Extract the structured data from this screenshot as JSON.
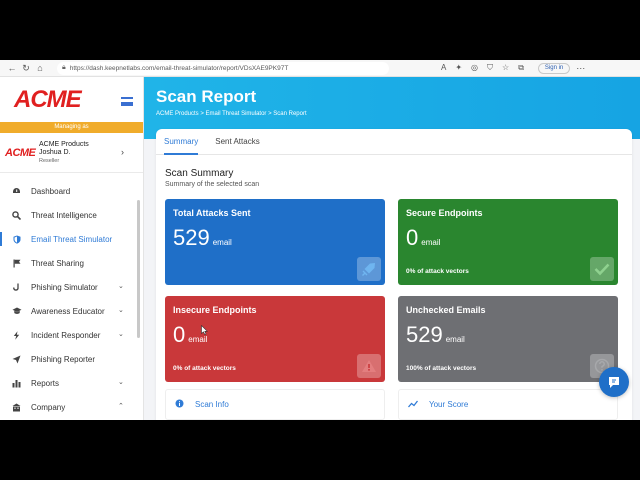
{
  "browser": {
    "url": "https://dash.keepnetlabs.com/email-threat-simulator/report/VDsXAE9PK97T",
    "sign_in_label": "Sign in"
  },
  "sidebar": {
    "brand": "ACME",
    "managing_label": "Managing as",
    "account": {
      "company": "ACME Products",
      "user": "Joshua D.",
      "role": "Reseller"
    },
    "items": [
      {
        "label": "Dashboard",
        "icon": "dashboard-icon"
      },
      {
        "label": "Threat Intelligence",
        "icon": "search-icon"
      },
      {
        "label": "Email Threat Simulator",
        "icon": "shield-icon",
        "active": true
      },
      {
        "label": "Threat Sharing",
        "icon": "flag-icon"
      },
      {
        "label": "Phishing Simulator",
        "icon": "hook-icon",
        "expandable": true
      },
      {
        "label": "Awareness Educator",
        "icon": "graduation-cap-icon",
        "expandable": true
      },
      {
        "label": "Incident Responder",
        "icon": "bolt-icon",
        "expandable": true
      },
      {
        "label": "Phishing Reporter",
        "icon": "paper-plane-icon"
      },
      {
        "label": "Reports",
        "icon": "bar-chart-icon",
        "expandable": true
      },
      {
        "label": "Company",
        "icon": "building-icon",
        "expandable": true,
        "expanded": true
      }
    ]
  },
  "header": {
    "title": "Scan Report",
    "breadcrumb": "ACME Products > Email Threat Simulator > Scan Report"
  },
  "tabs": [
    {
      "label": "Summary",
      "active": true
    },
    {
      "label": "Sent Attacks"
    }
  ],
  "summary": {
    "title": "Scan Summary",
    "subtitle": "Summary of the selected scan",
    "tiles": [
      {
        "label": "Total Attacks Sent",
        "value": "529",
        "unit": "email",
        "footer": "",
        "color": "#1f6fc8",
        "icon": "sword-icon"
      },
      {
        "label": "Secure Endpoints",
        "value": "0",
        "unit": "email",
        "footer": "0% of attack vectors",
        "color": "#2a862f",
        "icon": "check-icon"
      },
      {
        "label": "Insecure Endpoints",
        "value": "0",
        "unit": "email",
        "footer": "0% of attack vectors",
        "color": "#c9383a",
        "icon": "warning-icon"
      },
      {
        "label": "Unchecked Emails",
        "value": "529",
        "unit": "email",
        "footer": "100% of attack vectors",
        "color": "#6e6f73",
        "icon": "question-icon"
      }
    ]
  },
  "panels": {
    "scan_info": "Scan Info",
    "your_score": "Your Score"
  }
}
